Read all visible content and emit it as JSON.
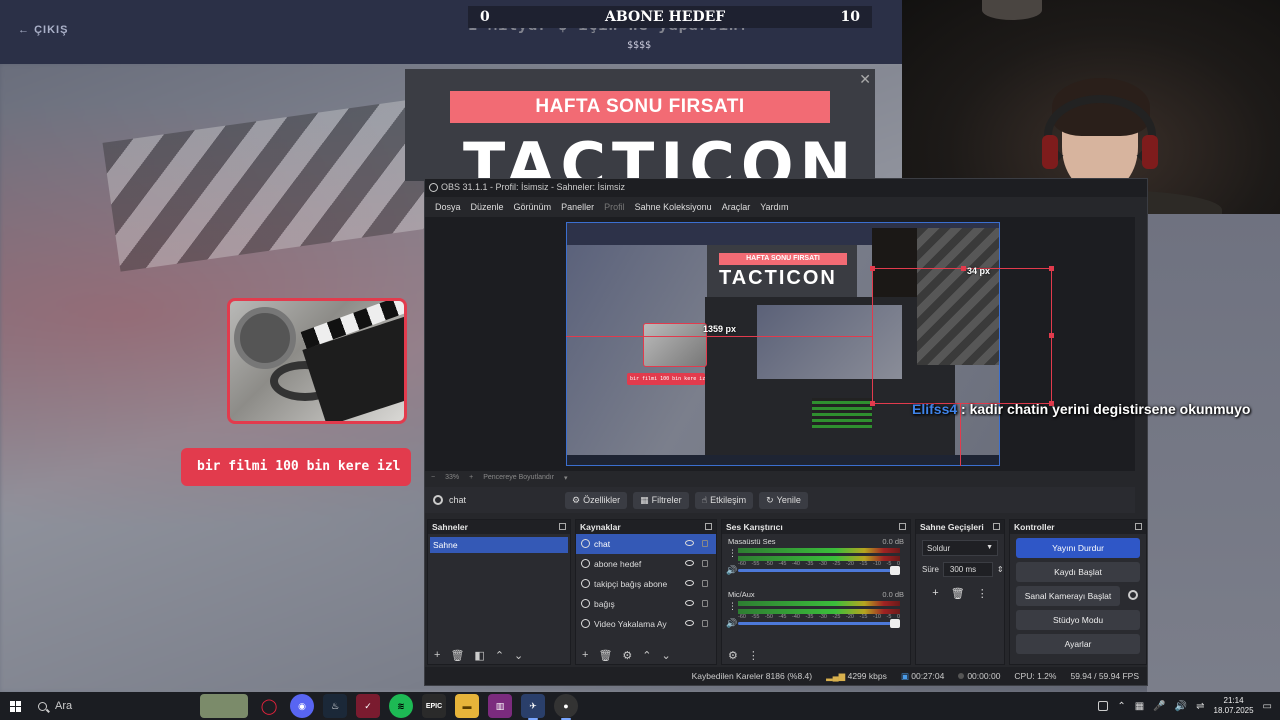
{
  "stream": {
    "back_label": "ÇIKIŞ",
    "goal": {
      "start": "0",
      "title": "ABONE HEDEF",
      "end": "10"
    },
    "question": "1 Milyar $ için ne yaparsın?",
    "dollars": "$$$$",
    "chat_pill": "bir filmi 100 bin kere izl",
    "ad": {
      "banner": "HAFTA SONU FIRSATI",
      "big_text": "TACTICON"
    },
    "chat_message": {
      "user": "Elifss4",
      "separator": ":",
      "text": "kadir chatin yerini degistirsene okunmuyo"
    }
  },
  "obs": {
    "title": "OBS 31.1.1 - Profil: İsimsiz - Sahneler: İsimsiz",
    "menu": [
      "Dosya",
      "Düzenle",
      "Görünüm",
      "Paneller",
      "Profil",
      "Sahne Koleksiyonu",
      "Araçlar",
      "Yardım"
    ],
    "preview": {
      "px_label_top": "34 px",
      "px_label_left": "1359 px",
      "banner": "HAFTA SONU FIRSATI",
      "big": "TACTICON",
      "pill": "bir filmi 100 bin kere izl",
      "chat_snippet": "kadir chatin yerini degistirsene okunmuyo"
    },
    "zoom": {
      "minus": "−",
      "value": "33%",
      "plus": "+",
      "fit": "Pencereye Boyutlandır",
      "caret": "▾"
    },
    "source_bar": {
      "selected": "chat",
      "props": "Özellikler",
      "filters": "Filtreler",
      "interact": "Etkileşim",
      "refresh": "Yenile"
    },
    "scenes": {
      "title": "Sahneler",
      "items": [
        "Sahne"
      ]
    },
    "sources": {
      "title": "Kaynaklar",
      "items": [
        "chat",
        "abone hedef",
        "takipçi bağış abone",
        "bağış",
        "Video Yakalama Ay"
      ]
    },
    "mixer": {
      "title": "Ses Karıştırıcı",
      "tracks": [
        {
          "name": "Masaüstü Ses",
          "db": "0.0 dB",
          "level": 0.9
        },
        {
          "name": "Mic/Aux",
          "db": "0.0 dB",
          "level": 0.9
        }
      ],
      "scale": [
        "-60",
        "-55",
        "-50",
        "-45",
        "-40",
        "-35",
        "-30",
        "-25",
        "-20",
        "-15",
        "-10",
        "-5",
        "0"
      ]
    },
    "transitions": {
      "title": "Sahne Geçişleri",
      "selected": "Soldur",
      "duration_label": "Süre",
      "duration": "300 ms"
    },
    "controls": {
      "title": "Kontroller",
      "stop_stream": "Yayını Durdur",
      "start_record": "Kaydı Başlat",
      "virtual_cam": "Sanal Kamerayı Başlat",
      "studio": "Stüdyo Modu",
      "settings": "Ayarlar"
    },
    "status": {
      "dropped": "Kaybedilen Kareler 8186 (%8.4)",
      "bitrate": "4299 kbps",
      "stream_time": "00:27:04",
      "rec_time": "00:00:00",
      "cpu": "CPU: 1.2%",
      "fps": "59.94 / 59.94 FPS"
    }
  },
  "taskbar": {
    "search": "Ara",
    "apps": [
      "face-thumbnail",
      "opera-gx",
      "discord",
      "steam",
      "vlc",
      "spotify",
      "epic-games",
      "file-explorer",
      "winrar",
      "steam-2",
      "obs"
    ],
    "time": "21:14",
    "date": "18.07.2025"
  },
  "colors": {
    "accent_red": "#e23b4d",
    "obs_blue": "#2f57c7",
    "chat_user": "#3f83e8"
  }
}
